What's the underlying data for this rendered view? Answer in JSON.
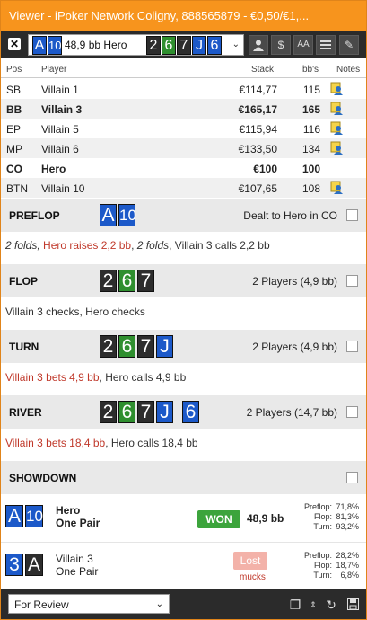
{
  "window": {
    "title": "Viewer - iPoker Network Coligny, 888565879 - €0,50/€1,..."
  },
  "toolbar": {
    "hand_cards": [
      {
        "rank": "A",
        "suit": "d"
      },
      {
        "rank": "10",
        "suit": "d"
      }
    ],
    "hand_label": "48,9 bb Hero",
    "board_cards": [
      {
        "rank": "2",
        "suit": "s"
      },
      {
        "rank": "6",
        "suit": "c"
      },
      {
        "rank": "7",
        "suit": "s"
      },
      {
        "rank": "J",
        "suit": "d"
      },
      {
        "rank": "6",
        "suit": "d"
      }
    ],
    "buttons": [
      "person-icon",
      "dollar-icon",
      "font-size-icon",
      "list-icon",
      "edit-icon"
    ],
    "dollar_glyph": "$",
    "font_glyph": "AA"
  },
  "table": {
    "headers": {
      "pos": "Pos",
      "player": "Player",
      "stack": "Stack",
      "bbs": "bb's",
      "notes": "Notes"
    },
    "rows": [
      {
        "pos": "SB",
        "player": "Villain 1",
        "stack": "€114,77",
        "bbs": "115",
        "note": true,
        "bold": false
      },
      {
        "pos": "BB",
        "player": "Villain 3",
        "stack": "€165,17",
        "bbs": "165",
        "note": true,
        "bold": true
      },
      {
        "pos": "EP",
        "player": "Villain 5",
        "stack": "€115,94",
        "bbs": "116",
        "note": true,
        "bold": false
      },
      {
        "pos": "MP",
        "player": "Villain 6",
        "stack": "€133,50",
        "bbs": "134",
        "note": true,
        "bold": false
      },
      {
        "pos": "CO",
        "player": "Hero",
        "stack": "€100",
        "bbs": "100",
        "note": false,
        "bold": true
      },
      {
        "pos": "BTN",
        "player": "Villain 10",
        "stack": "€107,65",
        "bbs": "108",
        "note": true,
        "bold": false
      }
    ]
  },
  "streets": {
    "preflop": {
      "name": "PREFLOP",
      "info": "Dealt to Hero in CO",
      "cards": [
        {
          "rank": "A"
        },
        {
          "rank": "10"
        }
      ],
      "action": [
        {
          "t": "2 folds, ",
          "style": "i"
        },
        {
          "t": "Hero raises 2,2 bb",
          "style": "r"
        },
        {
          "t": ", ",
          "style": "n"
        },
        {
          "t": "2 folds",
          "style": "i"
        },
        {
          "t": ", Villain 3 calls 2,2 bb",
          "style": "n"
        }
      ]
    },
    "flop": {
      "name": "FLOP",
      "info": "2 Players (4,9 bb)",
      "cards": [
        {
          "rank": "2"
        },
        {
          "rank": "6"
        },
        {
          "rank": "7"
        }
      ],
      "action": [
        {
          "t": "Villain 3 checks, Hero checks",
          "style": "n"
        }
      ]
    },
    "turn": {
      "name": "TURN",
      "info": "2 Players (4,9 bb)",
      "cards": [
        {
          "rank": "2"
        },
        {
          "rank": "6"
        },
        {
          "rank": "7"
        },
        {
          "rank": "J"
        }
      ],
      "action": [
        {
          "t": "Villain 3 bets 4,9 bb",
          "style": "r"
        },
        {
          "t": ", Hero calls 4,9 bb",
          "style": "n"
        }
      ]
    },
    "river": {
      "name": "RIVER",
      "info": "2 Players (14,7 bb)",
      "cards": [
        {
          "rank": "2"
        },
        {
          "rank": "6"
        },
        {
          "rank": "7"
        },
        {
          "rank": "J"
        },
        {
          "rank": "6"
        }
      ],
      "action": [
        {
          "t": "Villain 3 bets 18,4 bb",
          "style": "r"
        },
        {
          "t": ", Hero calls 18,4 bb",
          "style": "n"
        }
      ]
    },
    "showdown": {
      "name": "SHOWDOWN"
    }
  },
  "showdown": {
    "hero": {
      "cards": [
        {
          "rank": "A"
        },
        {
          "rank": "10"
        }
      ],
      "name": "Hero",
      "hand": "One Pair",
      "result": "WON",
      "amount": "48,9 bb",
      "equity": [
        {
          "label": "Preflop:",
          "value": "71,8%"
        },
        {
          "label": "Flop:",
          "value": "81,3%"
        },
        {
          "label": "Turn:",
          "value": "93,2%"
        }
      ]
    },
    "villain": {
      "cards": [
        {
          "rank": "3"
        },
        {
          "rank": "A"
        }
      ],
      "name": "Villain 3",
      "hand": "One Pair",
      "result": "Lost",
      "sub": "mucks",
      "equity": [
        {
          "label": "Preflop:",
          "value": "28,2%"
        },
        {
          "label": "Flop:",
          "value": "18,7%"
        },
        {
          "label": "Turn:",
          "value": "6,8%"
        }
      ]
    }
  },
  "footer": {
    "select_value": "For Review"
  },
  "colors": {
    "accent": "#f7941d",
    "toolbar": "#2b2b2b",
    "won": "#3ca43c",
    "lost": "#f3b2a9",
    "red_text": "#c0392b"
  }
}
